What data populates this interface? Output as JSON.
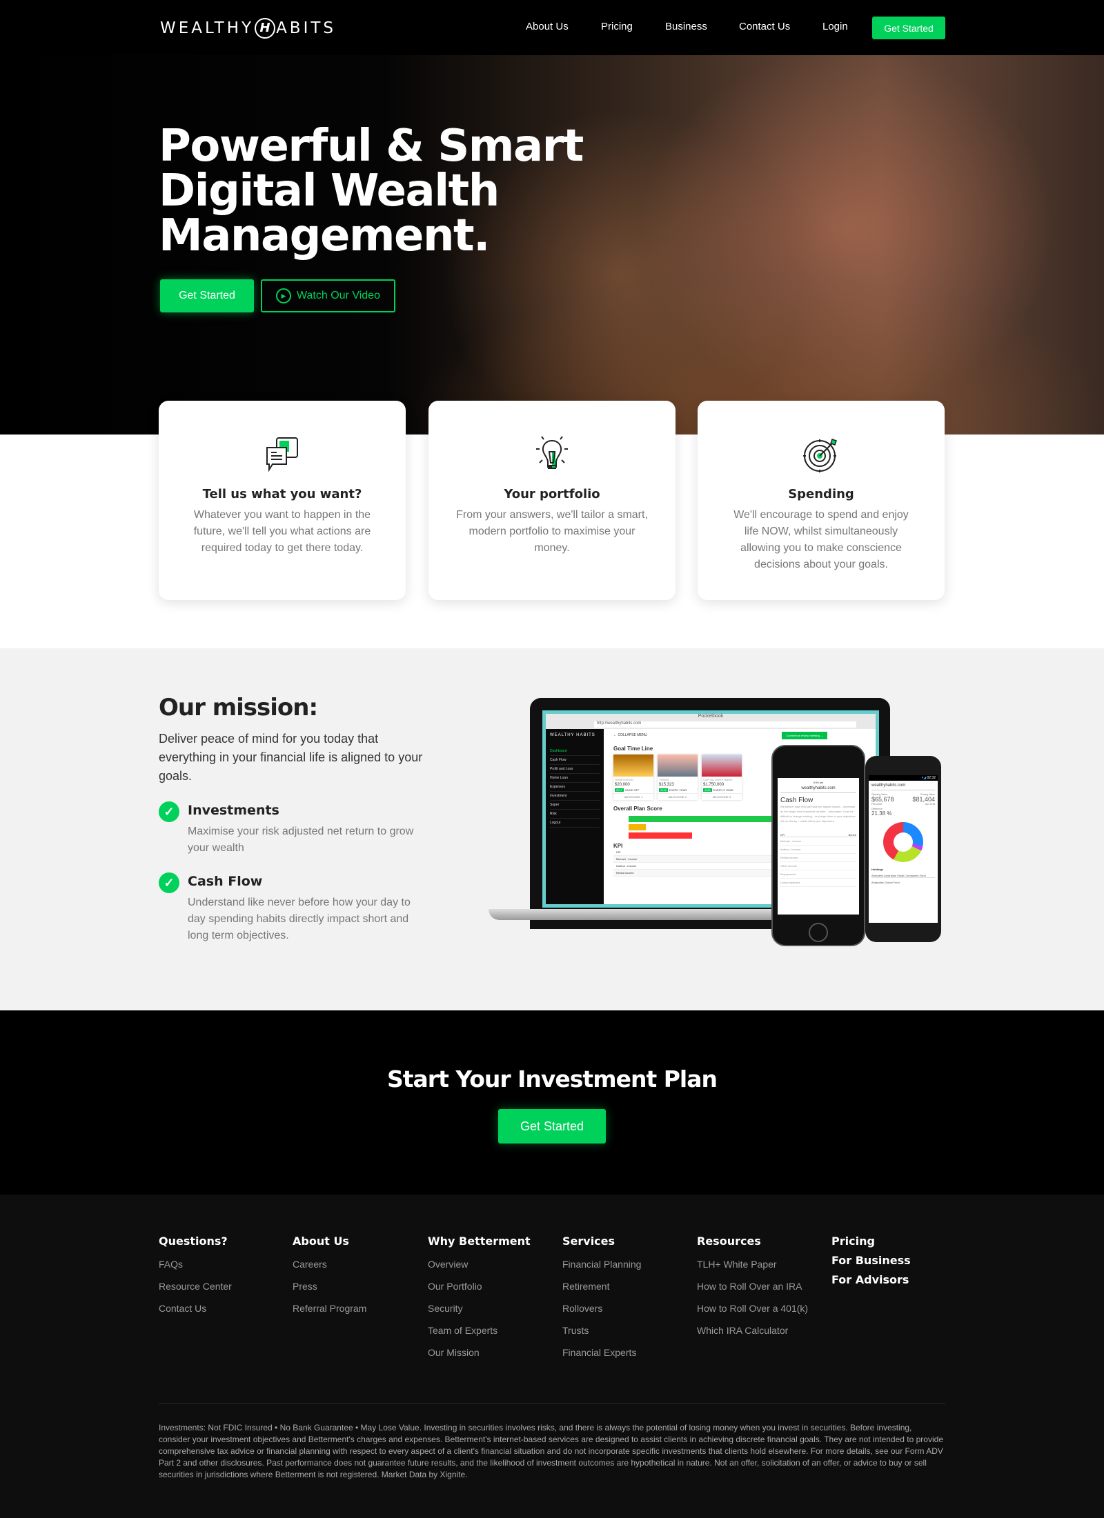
{
  "nav": {
    "logo": "WEALTHY HABITS",
    "logo_left": "WEALTHY",
    "logo_mark": "H",
    "logo_right": "ABITS",
    "links": [
      "About Us",
      "Pricing",
      "Business",
      "Contact Us",
      "Login"
    ],
    "cta": "Get Started"
  },
  "hero": {
    "headline_lines": [
      "Powerful & Smart",
      "Digital Wealth",
      "Management."
    ],
    "primary": "Get Started",
    "secondary": "Watch Our Video"
  },
  "cards": [
    {
      "icon": "chat-bubbles-icon",
      "title": "Tell us what you want?",
      "text": "Whatever you want to happen in the future, we'll tell you what actions are required today to get there today."
    },
    {
      "icon": "lightbulb-icon",
      "title": "Your portfolio",
      "text": "From your answers, we'll tailor a smart, modern portfolio to maximise your money."
    },
    {
      "icon": "target-icon",
      "title": "Spending",
      "text": "We'll encourage to spend and enjoy life NOW, whilst simultaneously allowing you to make conscience decisions about your goals."
    }
  ],
  "mission": {
    "title": "Our mission:",
    "text": "Deliver peace of mind for you today that everything in your financial life is aligned to your goals.",
    "items": [
      {
        "title": "Investments",
        "text": "Maximise your risk adjusted net return to grow your wealth"
      },
      {
        "title": "Cash Flow",
        "text": "Understand like never before how your day to day spending habits directly impact short and long term objectives."
      }
    ]
  },
  "mockup": {
    "window_title": "Pocketbook",
    "url": "http://wealthyhabits.com",
    "collapse": "← COLLAPSE MENU",
    "review_btn": "Commence review meeting →",
    "menu": [
      "Dashboard",
      "Cash Flow",
      "Profit and Loss",
      "Home Loan",
      "Expenses",
      "Investment",
      "Super",
      "Risk",
      "Logout"
    ],
    "goal_title": "Goal Time Line",
    "goals": [
      {
        "label": "HONEYMOON",
        "amount": "$20,000",
        "year": "2017",
        "freq": "ONCE OFF",
        "milestone": "MILESTONE 1"
      },
      {
        "label": "TRAVEL",
        "amount": "$15,323",
        "year": "2018",
        "freq": "EVERY YEAR",
        "milestone": "MILESTONE 2"
      },
      {
        "label": "CAPITAL INVESTMENT",
        "amount": "$1,750,000",
        "year": "2022",
        "freq": "EVERY 5 YEAR",
        "milestone": "MILESTONE 3"
      }
    ],
    "score_title": "Overall Plan Score",
    "kpi_title": "KPI",
    "kpi_rows": [
      "KPI",
      "Michael - Income",
      "Katrina - Income",
      "Rental income"
    ],
    "phone1": {
      "time": "9:59 am",
      "site": "wealthyhabits.com",
      "title": "Cash Flow",
      "text": "We believe cash flow will have the largest impact... expenses as the single most important variable... automated, it can be difficult to change existing... and align them to your objectives. We do this by... habits effect your objectives.",
      "kpi": "KPI",
      "bench": "Bench",
      "rows": [
        "Michael - Income",
        "Katrina - Income",
        "Rental income",
        "Other income",
        "Repayments",
        "Living expenses"
      ]
    },
    "phone2": {
      "time": "02:32",
      "site": "wealthyhabits.com",
      "opening_label": "Opening Value",
      "opening": "$65,678",
      "opening_date": "Feb 2018",
      "closing_label": "Closing Value",
      "closing": "$81,404",
      "closing_date": "Apr 2018",
      "diff_label": "Difference",
      "diff": "21.38 %",
      "holdings": "Holdings",
      "funds": [
        "Aberdeen Australian Small Companies Fund",
        "Antipodes Global Fund"
      ]
    }
  },
  "cta": {
    "title": "Start Your Investment Plan",
    "button": "Get Started"
  },
  "footer": {
    "columns": [
      {
        "title": "Questions?",
        "links": [
          "FAQs",
          "Resource Center",
          "Contact Us"
        ]
      },
      {
        "title": "About Us",
        "links": [
          "Careers",
          "Press",
          "Referral Program"
        ]
      },
      {
        "title": "Why Betterment",
        "links": [
          "Overview",
          "Our Portfolio",
          "Security",
          "Team of Experts",
          "Our Mission"
        ]
      },
      {
        "title": "Services",
        "links": [
          "Financial Planning",
          "Retirement",
          "Rollovers",
          "Trusts",
          "Financial Experts"
        ]
      },
      {
        "title": "Resources",
        "links": [
          "TLH+ White Paper",
          "How to Roll Over an IRA",
          "How to Roll Over a 401(k)",
          "Which IRA Calculator"
        ]
      }
    ],
    "extra": [
      "Pricing",
      "For Business",
      "For Advisors"
    ],
    "disclaimer": "Investments: Not FDIC Insured • No Bank Guarantee • May Lose Value. Investing in securities involves risks, and there is always the potential of losing money when you invest in securities. Before investing, consider your investment objectives and Betterment's charges and expenses. Betterment's internet-based services are designed to assist clients in achieving discrete financial goals. They are not intended to provide comprehensive tax advice or financial planning with respect to every aspect of a client's financial situation and do not incorporate specific investments that clients hold elsewhere. For more details, see our Form ADV Part 2 and other disclosures. Past performance does not guarantee future results, and the likelihood of investment outcomes are hypothetical in nature. Not an offer, solicitation of an offer, or advice to buy or sell securities in jurisdictions where Betterment is not registered. Market Data by Xignite."
  },
  "colors": {
    "accent": "#00d15a",
    "dark": "#000000",
    "footer": "#0e0e0e",
    "section": "#f2f2f2"
  }
}
